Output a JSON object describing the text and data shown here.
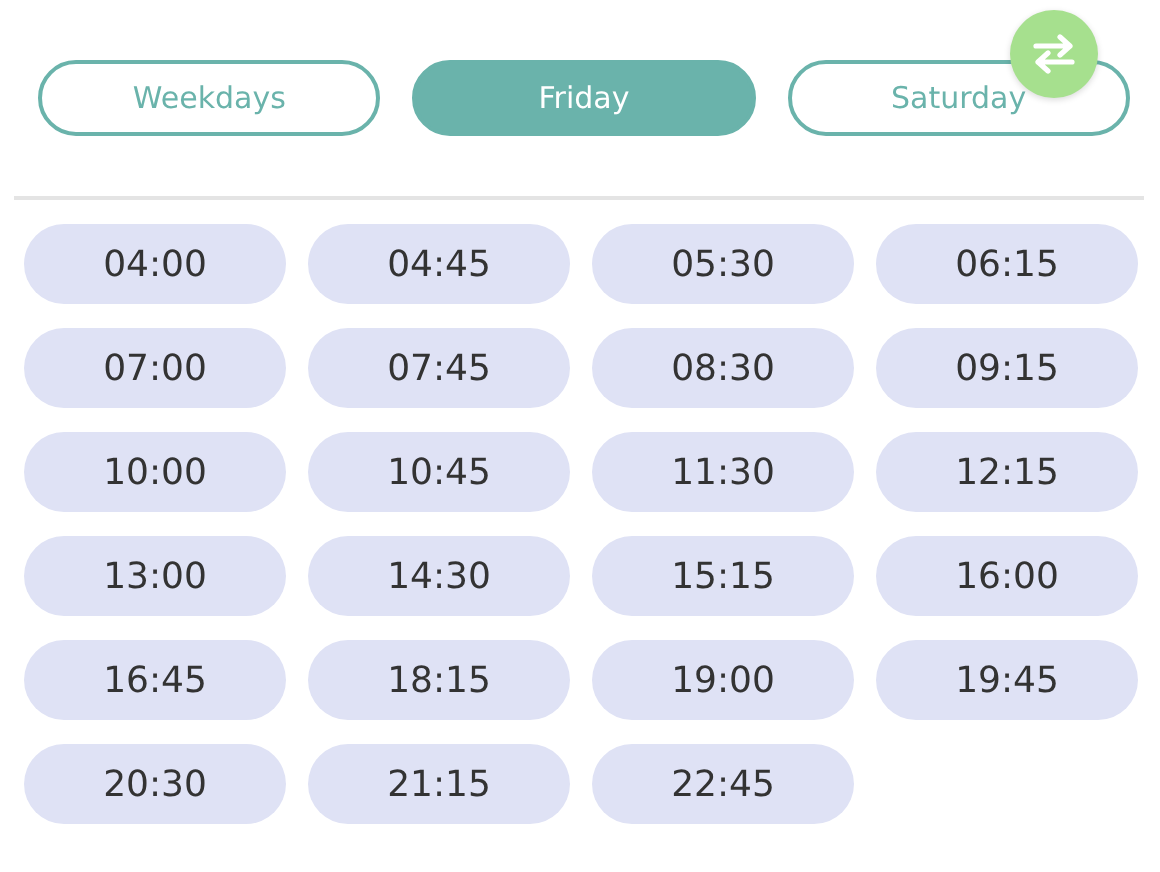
{
  "tabs": [
    {
      "label": "Weekdays",
      "selected": false
    },
    {
      "label": "Friday",
      "selected": true
    },
    {
      "label": "Saturday",
      "selected": false
    }
  ],
  "times": [
    "04:00",
    "04:45",
    "05:30",
    "06:15",
    "07:00",
    "07:45",
    "08:30",
    "09:15",
    "10:00",
    "10:45",
    "11:30",
    "12:15",
    "13:00",
    "14:30",
    "15:15",
    "16:00",
    "16:45",
    "18:15",
    "19:00",
    "19:45",
    "20:30",
    "21:15",
    "22:45"
  ]
}
